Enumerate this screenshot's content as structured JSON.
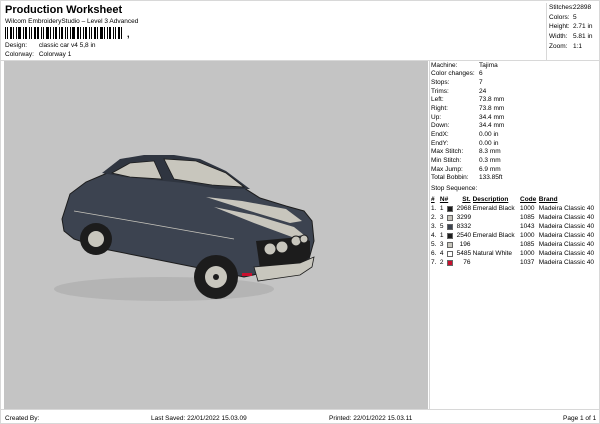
{
  "header": {
    "title": "Production Worksheet",
    "subtitle": "Wilcom EmbroideryStudio – Level 3 Advanced",
    "barcode_mark": ","
  },
  "meta": {
    "design_label": "Design:",
    "design_value": "classic car v4 5,8 in",
    "colorway_label": "Colorway:",
    "colorway_value": "Colorway 1"
  },
  "stats": [
    {
      "label": "Stitches:",
      "value": "22898"
    },
    {
      "label": "Colors:",
      "value": "5"
    },
    {
      "label": "Height:",
      "value": "2.71 in"
    },
    {
      "label": "Width:",
      "value": "5.81 in"
    },
    {
      "label": "Zoom:",
      "value": "1:1"
    }
  ],
  "machine": [
    {
      "label": "Machine:",
      "value": "Tajima"
    },
    {
      "label": "Color changes:",
      "value": "6"
    },
    {
      "label": "Stops:",
      "value": "7"
    },
    {
      "label": "Trims:",
      "value": "24"
    },
    {
      "label": "Left:",
      "value": "73.8 mm"
    },
    {
      "label": "Right:",
      "value": "73.8 mm"
    },
    {
      "label": "Up:",
      "value": "34.4 mm"
    },
    {
      "label": "Down:",
      "value": "34.4 mm"
    },
    {
      "label": "EndX:",
      "value": "0.00 in"
    },
    {
      "label": "EndY:",
      "value": "0.00 in"
    },
    {
      "label": "Max Stitch:",
      "value": "8.3 mm"
    },
    {
      "label": "Min Stitch:",
      "value": "0.3 mm"
    },
    {
      "label": "Max Jump:",
      "value": "6.9 mm"
    },
    {
      "label": "Total Bobbin:",
      "value": "133.85ft"
    }
  ],
  "stop_sequence": {
    "label": "Stop Sequence:",
    "headers": {
      "stop": "#",
      "num": "N#",
      "st": "St.",
      "desc": "Description",
      "code": "Code",
      "brand": "Brand"
    },
    "rows": [
      {
        "stop": "1.",
        "num": "1",
        "color": "#1c1c1c",
        "st": "2968",
        "desc": "Emerald Black",
        "code": "1000",
        "brand": "Madeira Classic 40"
      },
      {
        "stop": "2.",
        "num": "3",
        "color": "#c8c6bd",
        "st": "3299",
        "desc": "",
        "code": "1085",
        "brand": "Madeira Classic 40"
      },
      {
        "stop": "3.",
        "num": "5",
        "color": "#3c4350",
        "st": "8332",
        "desc": "",
        "code": "1043",
        "brand": "Madeira Classic 40"
      },
      {
        "stop": "4.",
        "num": "1",
        "color": "#1c1c1c",
        "st": "2540",
        "desc": "Emerald Black",
        "code": "1000",
        "brand": "Madeira Classic 40"
      },
      {
        "stop": "5.",
        "num": "3",
        "color": "#c8c6bd",
        "st": "196",
        "desc": "",
        "code": "1085",
        "brand": "Madeira Classic 40"
      },
      {
        "stop": "6.",
        "num": "4",
        "color": "#ffffff",
        "st": "5485",
        "desc": "Natural White",
        "code": "1000",
        "brand": "Madeira Classic 40"
      },
      {
        "stop": "7.",
        "num": "2",
        "color": "#c8102e",
        "st": "76",
        "desc": "",
        "code": "1037",
        "brand": "Madeira Classic 40"
      }
    ]
  },
  "footer": {
    "created_by": "Created By:",
    "last_saved": "Last Saved: 22/01/2022 15.03.09",
    "printed": "Printed: 22/01/2022 15.03.11",
    "page": "Page 1 of 1"
  },
  "colors": {
    "canvas_bg": "#c4c4c4",
    "car_body": "#3c4350",
    "car_stripe": "#c8c6bd",
    "car_dark": "#1c1c1c",
    "tail_light": "#c8102e"
  }
}
